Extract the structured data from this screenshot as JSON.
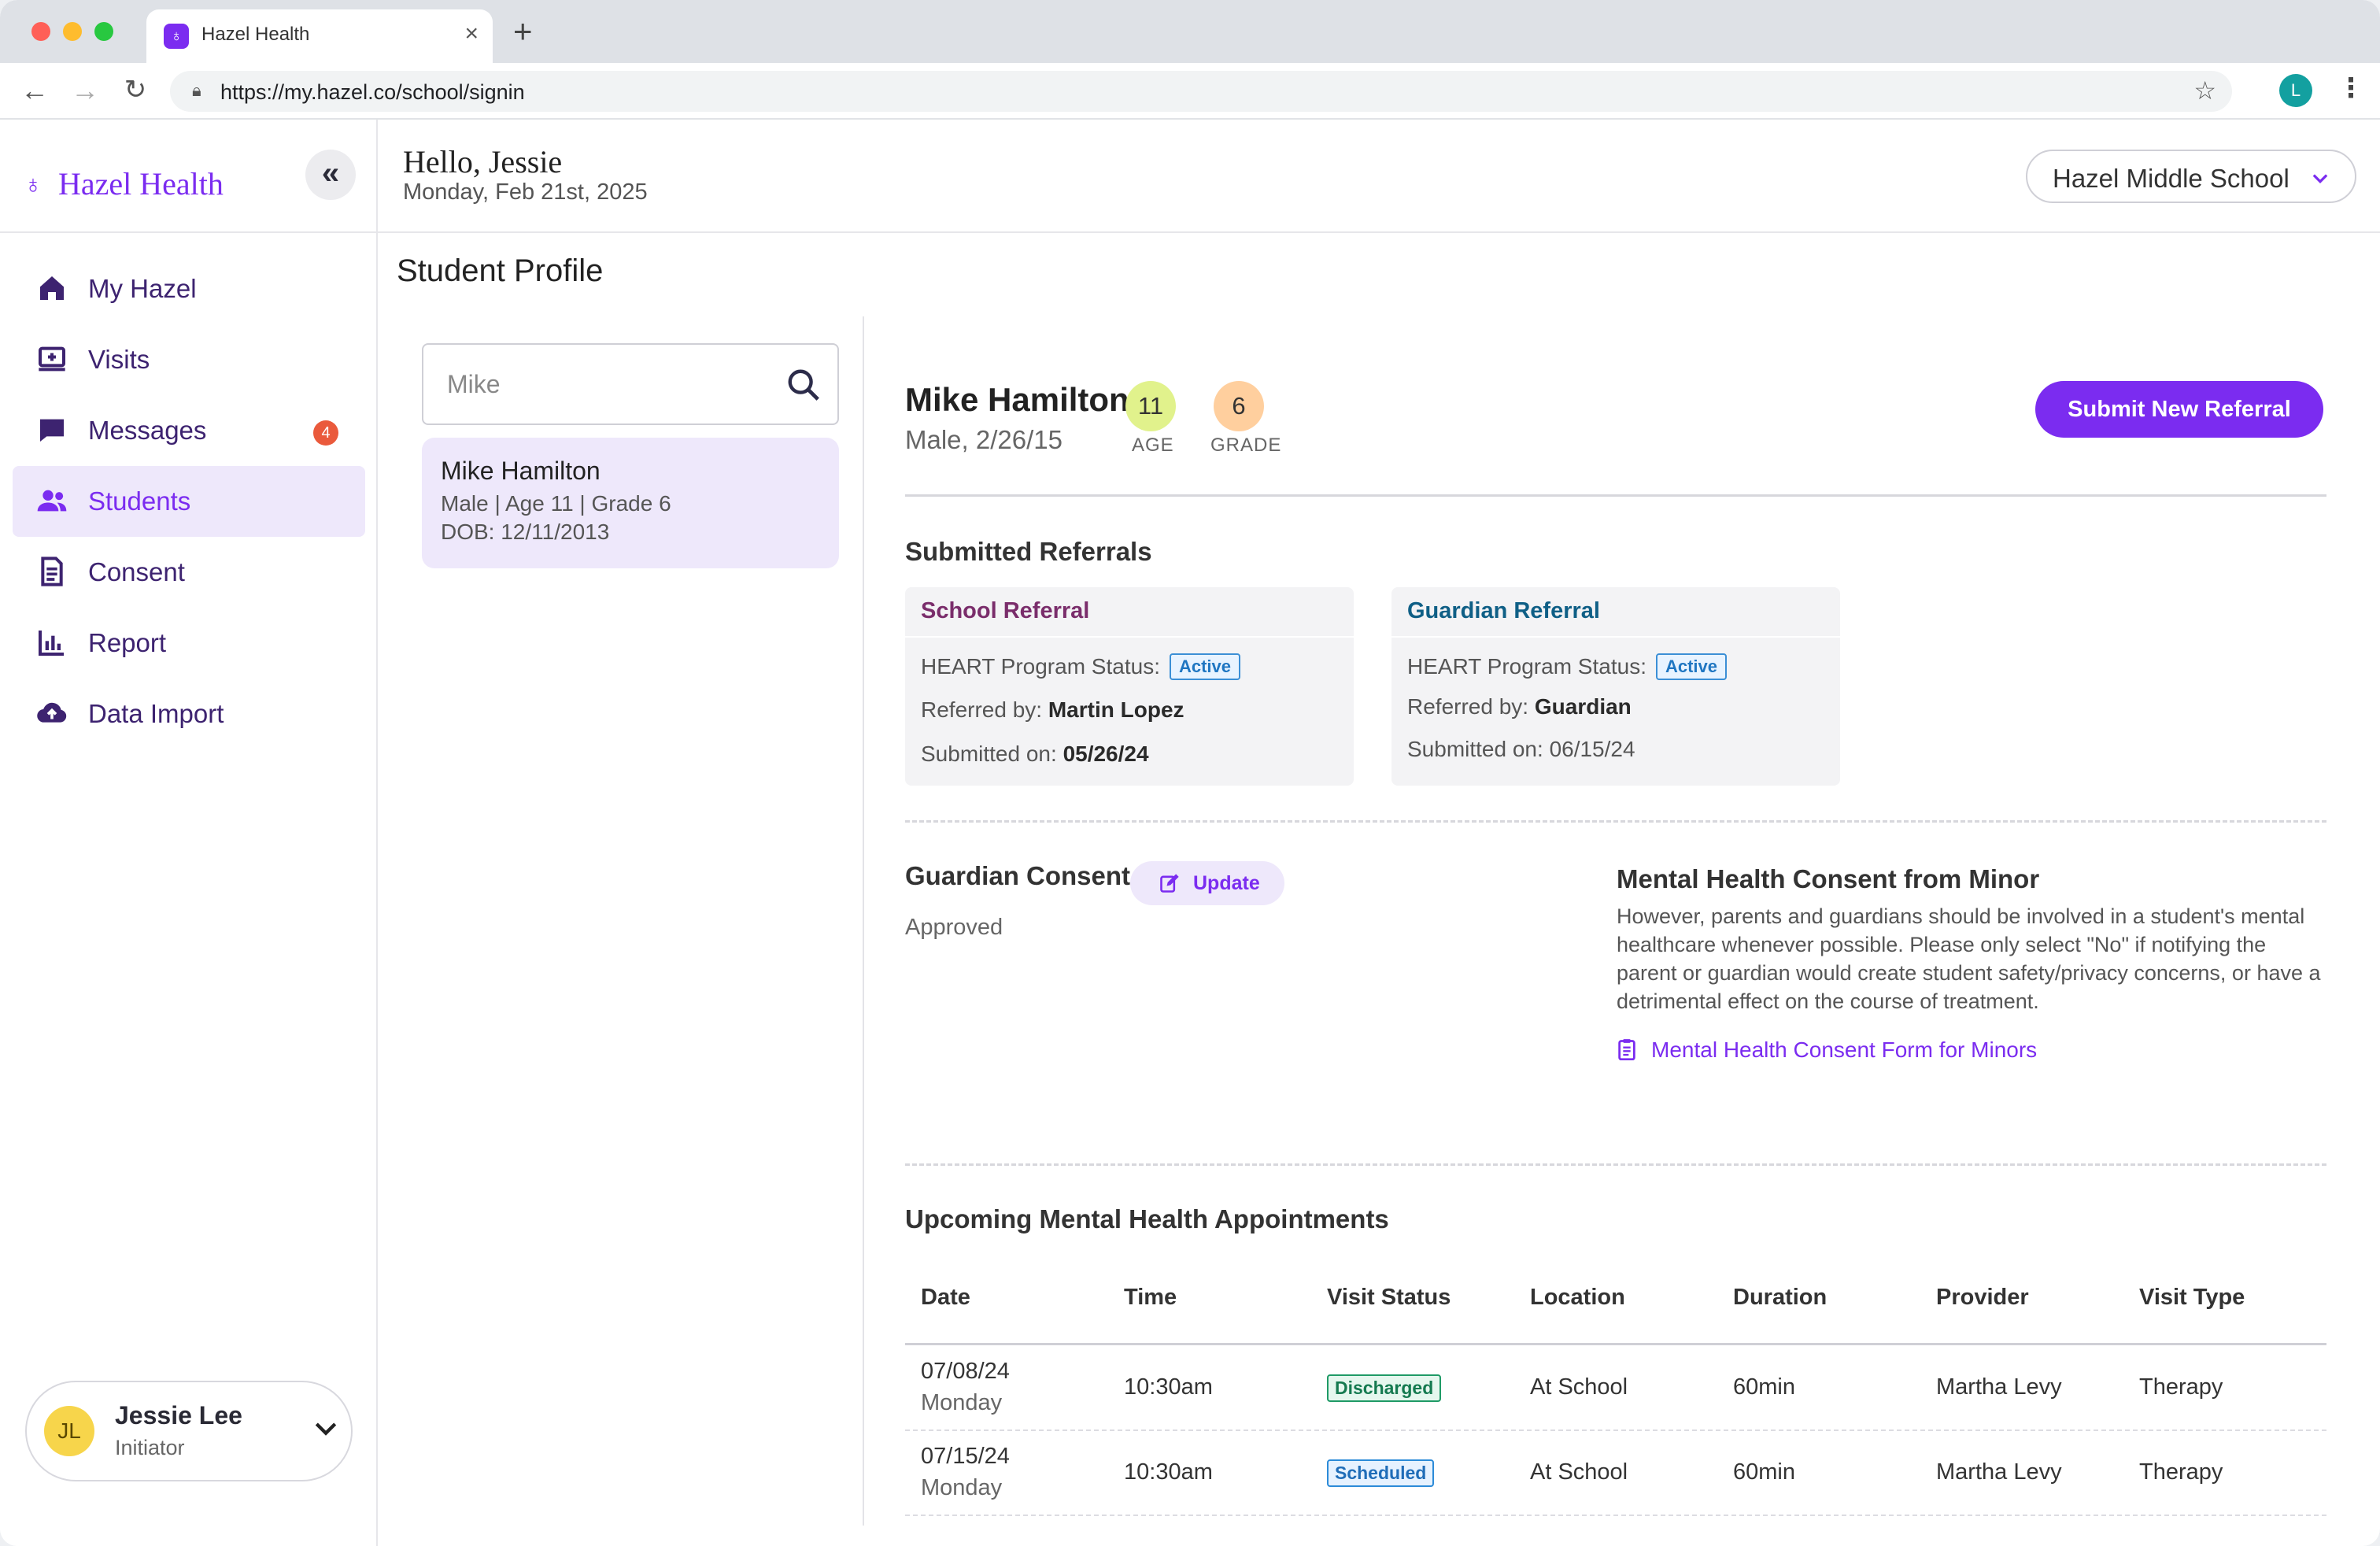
{
  "browser": {
    "tab_title": "Hazel Health",
    "tab_close": "×",
    "new_tab": "+",
    "url": "https://my.hazel.co/school/signin",
    "profile_initial": "L",
    "back_icon": "arrow-left-icon",
    "forward_icon": "arrow-right-icon",
    "reload_icon": "reload-icon"
  },
  "brand": {
    "name": "Hazel Health",
    "color": "#7b2cf0"
  },
  "sidebar": {
    "items": [
      {
        "label": "My Hazel",
        "icon": "home-icon"
      },
      {
        "label": "Visits",
        "icon": "visits-icon"
      },
      {
        "label": "Messages",
        "icon": "message-icon",
        "badge": "4"
      },
      {
        "label": "Students",
        "icon": "users-icon",
        "active": true
      },
      {
        "label": "Consent",
        "icon": "document-icon"
      },
      {
        "label": "Report",
        "icon": "chart-icon"
      },
      {
        "label": "Data Import",
        "icon": "cloud-upload-icon"
      }
    ],
    "user": {
      "initials": "JL",
      "name": "Jessie Lee",
      "role": "Initiator"
    }
  },
  "header": {
    "greeting": "Hello, Jessie",
    "date": "Monday, Feb 21st, 2025",
    "school": "Hazel Middle School"
  },
  "page": {
    "title": "Student Profile"
  },
  "search": {
    "value": "Mike",
    "result": {
      "name": "Mike Hamilton",
      "meta": "Male |  Age 11  | Grade 6",
      "dob": "DOB: 12/11/2013"
    }
  },
  "student": {
    "name": "Mike Hamilton",
    "sub": "Male, 2/26/15",
    "age": "11",
    "age_label": "AGE",
    "grade": "6",
    "grade_label": "GRADE",
    "cta": "Submit New Referral"
  },
  "referrals": {
    "title": "Submitted Referrals",
    "cards": [
      {
        "title": "School Referral",
        "title_color": "#7a2d6b",
        "status_label": "HEART Program Status:",
        "status": "Active",
        "referred_label": "Referred by:",
        "referred_by": "Martin Lopez",
        "submitted_label": "Submitted on:",
        "submitted_on": "05/26/24"
      },
      {
        "title": "Guardian Referral",
        "title_color": "#0f5f86",
        "status_label": "HEART Program Status:",
        "status": "Active",
        "referred_label": "Referred by:",
        "referred_by": "Guardian",
        "submitted_label": "Submitted on:",
        "submitted_on": "06/15/24"
      }
    ]
  },
  "consent": {
    "title": "Guardian Consent",
    "update_label": "Update",
    "status": "Approved",
    "minor_title": "Mental Health Consent from Minor",
    "minor_text": "However, parents and guardians should be involved in a student's mental healthcare whenever possible. Please only select \"No\" if notifying the parent or guardian would create student safety/privacy concerns, or have a detrimental effect on the course of treatment.",
    "link_label": "Mental Health Consent Form for Minors"
  },
  "appointments": {
    "title": "Upcoming Mental Health Appointments",
    "columns": [
      "Date",
      "Time",
      "Visit Status",
      "Location",
      "Duration",
      "Provider",
      "Visit Type"
    ],
    "rows": [
      {
        "date": "07/08/24",
        "day": "Monday",
        "time": "10:30am",
        "status": "Discharged",
        "location": "At School",
        "duration": "60min",
        "provider": "Martha Levy",
        "type": "Therapy"
      },
      {
        "date": "07/15/24",
        "day": "Monday",
        "time": "10:30am",
        "status": "Scheduled",
        "location": "At School",
        "duration": "60min",
        "provider": "Martha Levy",
        "type": "Therapy"
      }
    ]
  }
}
